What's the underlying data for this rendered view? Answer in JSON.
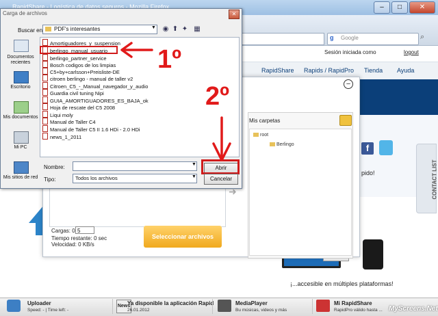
{
  "browser": {
    "title": "RapidShare - Logística de datos seguros - Mozilla Firefox",
    "search_placeholder": "Google",
    "search_engine_letter": "g"
  },
  "site": {
    "session_label": "Sesión iniciada como",
    "logout": "logout",
    "nav": [
      "RapidShare",
      "Rapids / RapidPro",
      "Tienda",
      "Ayuda"
    ],
    "rapido_text": "pido!",
    "contact_tab": "CONTACT LIST",
    "platforms_text": "¡...accesible en múltiples plataformas!",
    "facebook_letter": "f"
  },
  "upload_panel": {
    "my_folders": "Mis carpetas",
    "tree_root": "root",
    "tree_child": "Berlingo",
    "cargas_label": "Cargas: 0 /",
    "cargas_value": "5",
    "time_remaining": "Tiempo restante: 0 sec",
    "speed": "Velocidad: 0 KB/s",
    "select_files": "Seleccionar archivos"
  },
  "file_dialog": {
    "title": "Carga de archivos",
    "look_in_label": "Buscar en:",
    "look_in_value": "PDF's interesantes",
    "places": [
      {
        "label": "Documentos recientes"
      },
      {
        "label": "Escritorio"
      },
      {
        "label": "Mis documentos"
      },
      {
        "label": "Mi PC"
      },
      {
        "label": "Mis sitios de red"
      }
    ],
    "files": [
      "Amortiguadores_y_suspension",
      "berlingo_manual_usuario",
      "berlingo_partner_service",
      "Bosch codigos de los limpias",
      "C5+by+carlsson+Preisliste-DE",
      "citroen berlingo - manual de taller v2",
      "Citroen_C5_-_Manual_navegador_y_audio",
      "Guardia civil tuning Nipi",
      "GUIA_AMORTIGUADORES_ES_BAJA_ok",
      "Hoja de rescate del C5 2008",
      "Liqui moly",
      "Manual de Taller C4",
      "Manual de Taller C5 II 1.6 HDi - 2.0 HDi",
      "news_1_2011"
    ],
    "name_label": "Nombre:",
    "type_label": "Tipo:",
    "type_value": "Todos los archivos",
    "open_button": "Abrir",
    "cancel_button": "Cancelar"
  },
  "annotations": {
    "step1": "1º",
    "step2": "2º",
    "color": "#e11a1a"
  },
  "bottom_bar": {
    "items": [
      {
        "title": "Uploader",
        "sub": "Speed: - | Time left: -"
      },
      {
        "title": "Ya disponible la aplicación Rapid",
        "sub": "26.01.2012"
      },
      {
        "title": "MediaPlayer",
        "sub": "Bu músicas, videos y más"
      },
      {
        "title": "Mi RapidShare",
        "sub": "RapidPro válido hasta ..."
      }
    ],
    "news_badge": "News",
    "watermark": "MyScreens.Net"
  }
}
